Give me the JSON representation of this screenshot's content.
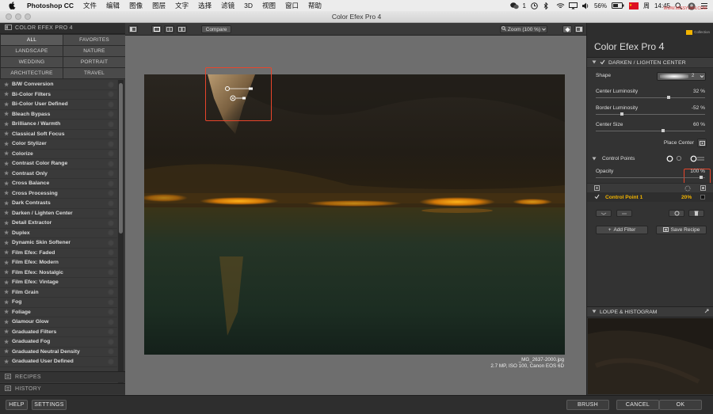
{
  "menubar": {
    "app": "Photoshop CC",
    "menus": [
      "文件",
      "编辑",
      "图像",
      "图层",
      "文字",
      "选择",
      "滤镜",
      "3D",
      "视图",
      "窗口",
      "帮助"
    ],
    "tray": {
      "wechat_count": "1",
      "battery": "56%",
      "time_prefix": "周",
      "time": "14:45",
      "watermark": "WWW.MISSYUAN.COM"
    }
  },
  "window": {
    "title": "Color Efex Pro 4"
  },
  "left_panel": {
    "header": "COLOR EFEX PRO 4",
    "categories": [
      "ALL",
      "FAVORITES",
      "LANDSCAPE",
      "NATURE",
      "WEDDING",
      "PORTRAIT",
      "ARCHITECTURE",
      "TRAVEL"
    ],
    "filters": [
      "B/W Conversion",
      "Bi-Color Filters",
      "Bi-Color User Defined",
      "Bleach Bypass",
      "Brilliance / Warmth",
      "Classical Soft Focus",
      "Color Stylizer",
      "Colorize",
      "Contrast Color Range",
      "Contrast Only",
      "Cross Balance",
      "Cross Processing",
      "Dark Contrasts",
      "Darken / Lighten Center",
      "Detail Extractor",
      "Duplex",
      "Dynamic Skin Softener",
      "Film Efex: Faded",
      "Film Efex: Modern",
      "Film Efex: Nostalgic",
      "Film Efex: Vintage",
      "Film Grain",
      "Fog",
      "Foliage",
      "Glamour Glow",
      "Graduated Filters",
      "Graduated Fog",
      "Graduated Neutral Density",
      "Graduated User Defined"
    ],
    "recipes": "RECIPES",
    "history": "HISTORY"
  },
  "toolbar": {
    "compare": "Compare",
    "zoom": "Zoom (100 %)"
  },
  "image": {
    "filename": "_MG_2637-2000.jpg",
    "meta": "2.7 MP, ISO 100, Canon EOS 6D"
  },
  "right_panel": {
    "brand_title": "Color Efex Pro",
    "brand_version": "4",
    "brand_logo": "Collection",
    "section": "DARKEN / LIGHTEN CENTER",
    "shape_label": "Shape",
    "shape_value": "2",
    "controls": [
      {
        "label": "Center Luminosity",
        "value": "32 %",
        "level": 0.66
      },
      {
        "label": "Border Luminosity",
        "value": "-52 %",
        "level": 0.24
      },
      {
        "label": "Center Size",
        "value": "60 %",
        "level": 0.61
      }
    ],
    "place_center": "Place Center",
    "control_points": "Control Points",
    "opacity_label": "Opacity",
    "opacity_value": "100 %",
    "control_point_name": "Control Point 1",
    "control_point_value": "20%",
    "add_filter": "Add Filter",
    "save_recipe": "Save Recipe",
    "loupe": "LOUPE & HISTOGRAM"
  },
  "bottom": {
    "help": "HELP",
    "settings": "SETTINGS",
    "brush": "BRUSH",
    "cancel": "CANCEL",
    "ok": "OK"
  },
  "colors": {
    "accent": "#e8452b",
    "highlight_text": "#f2b400"
  }
}
